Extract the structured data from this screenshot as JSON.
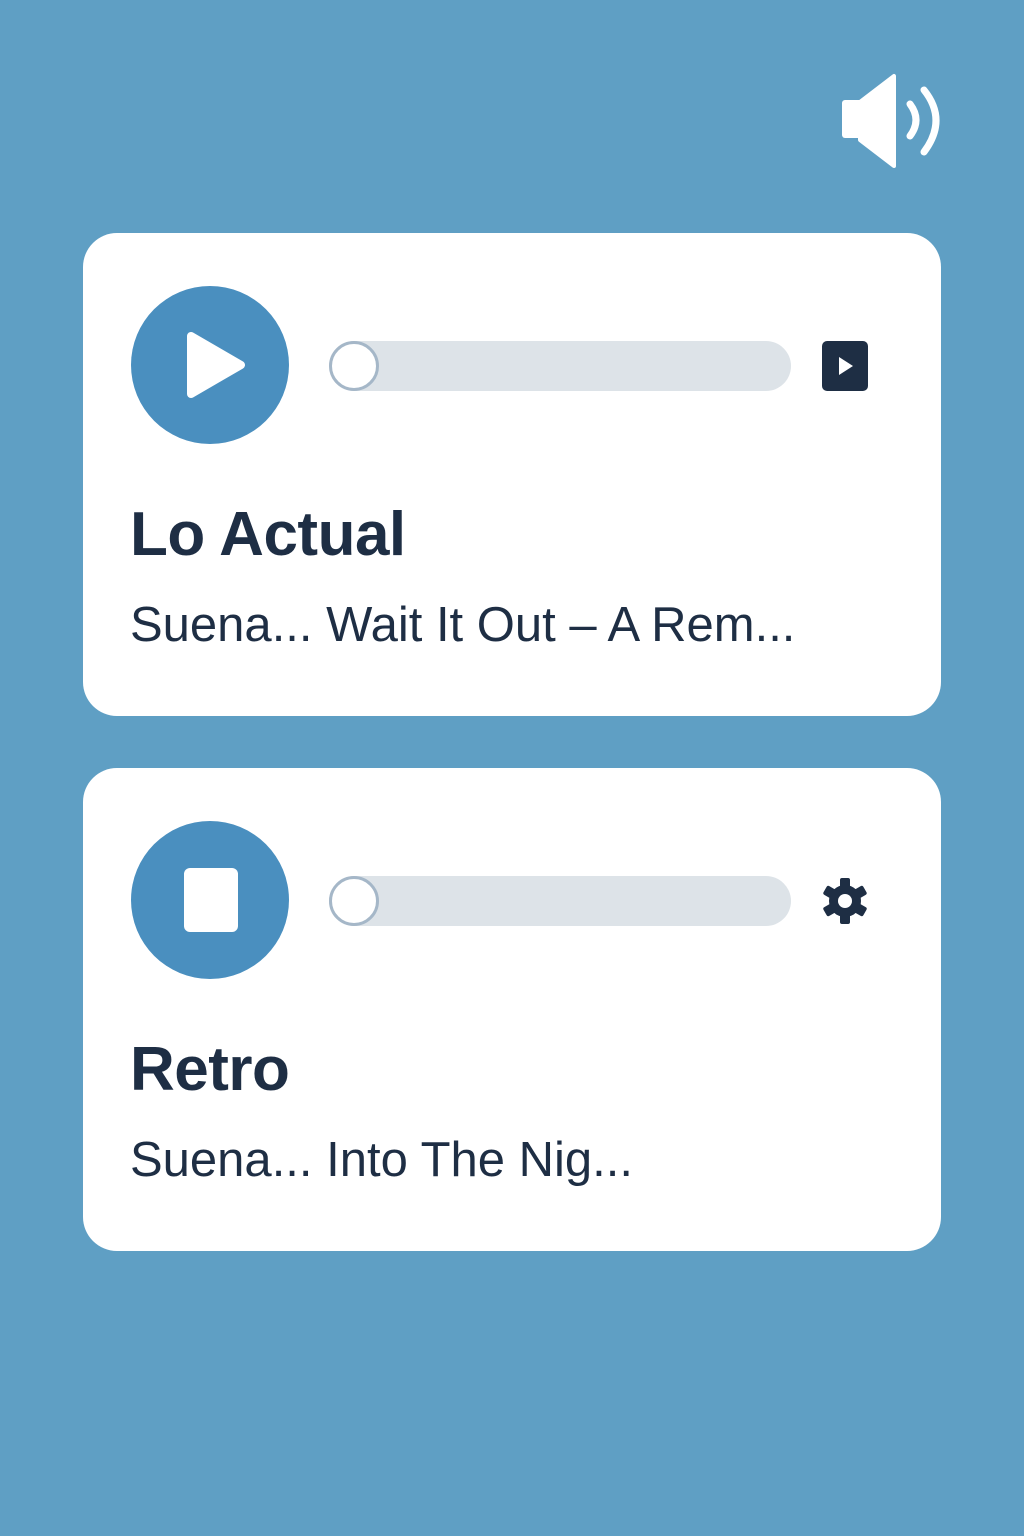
{
  "colors": {
    "background": "#5f9fc4",
    "card": "#ffffff",
    "accent": "#4a8fbf",
    "text": "#1e2e44",
    "track": "#dde3e8"
  },
  "header": {
    "volume_icon": "speaker-volume-icon"
  },
  "stations": [
    {
      "name": "Lo Actual",
      "now_playing": "Suena... Wait It Out – A Rem...",
      "control_icon": "play-icon",
      "side_icon": "play-square-icon",
      "progress": 0
    },
    {
      "name": "Retro",
      "now_playing": "Suena... Into The Nig...",
      "control_icon": "stop-icon",
      "side_icon": "gear-icon",
      "progress": 0
    }
  ]
}
